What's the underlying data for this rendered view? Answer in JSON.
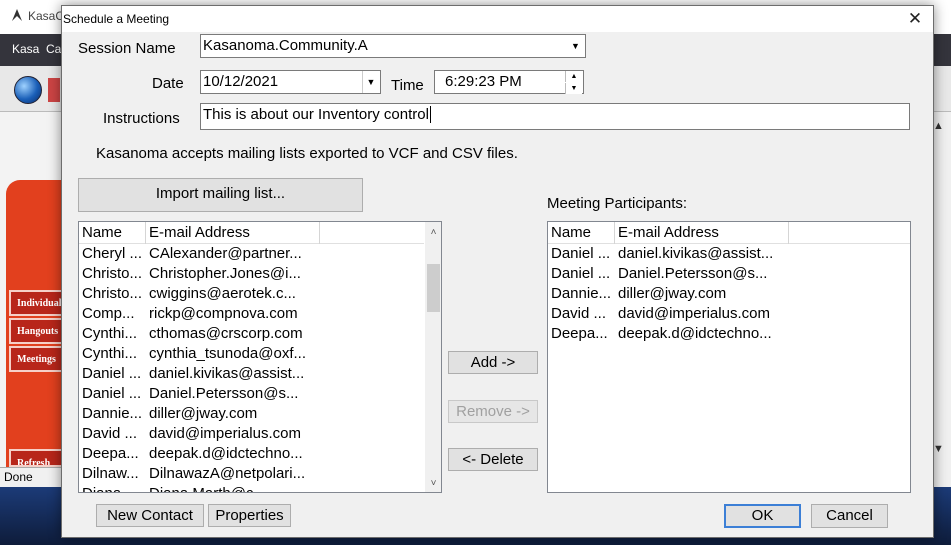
{
  "background_app": {
    "title": "KasaC",
    "menu": [
      "Kasa",
      "Ca"
    ],
    "nav_buttons": [
      "Individuals",
      "Hangouts",
      "Meetings",
      "Refresh"
    ],
    "status": "Done"
  },
  "dialog": {
    "title": "Schedule a Meeting",
    "close_glyph": "✕",
    "session_name": {
      "label": "Session Name",
      "value": "Kasanoma.Community.A"
    },
    "date": {
      "label": "Date",
      "value": "10/12/2021"
    },
    "time": {
      "label": "Time",
      "value": "6:29:23 PM"
    },
    "instructions": {
      "label": "Instructions",
      "value": "This is about our Inventory control"
    },
    "info_text": "Kasanoma accepts mailing lists exported to VCF and CSV files.",
    "import_button": "Import mailing list...",
    "participants_label": "Meeting Participants:",
    "columns": {
      "name": "Name",
      "email": "E-mail Address"
    },
    "contacts": [
      {
        "name": "Cheryl ...",
        "email": "CAlexander@partner..."
      },
      {
        "name": "Christo...",
        "email": "Christopher.Jones@i..."
      },
      {
        "name": "Christo...",
        "email": "cwiggins@aerotek.c..."
      },
      {
        "name": "Comp...",
        "email": "rickp@compnova.com"
      },
      {
        "name": "Cynthi...",
        "email": "cthomas@crscorp.com"
      },
      {
        "name": "Cynthi...",
        "email": "cynthia_tsunoda@oxf..."
      },
      {
        "name": "Daniel ...",
        "email": "daniel.kivikas@assist..."
      },
      {
        "name": "Daniel ...",
        "email": "Daniel.Petersson@s..."
      },
      {
        "name": "Dannie...",
        "email": "diller@jway.com"
      },
      {
        "name": "David ...",
        "email": "david@imperialus.com"
      },
      {
        "name": "Deepa...",
        "email": "deepak.d@idctechno..."
      },
      {
        "name": "Dilnaw...",
        "email": "DilnawazA@netpolari..."
      },
      {
        "name": "Diana ...",
        "email": "Diana.Marth@c..."
      }
    ],
    "participants": [
      {
        "name": "Daniel ...",
        "email": "daniel.kivikas@assist..."
      },
      {
        "name": "Daniel ...",
        "email": "Daniel.Petersson@s..."
      },
      {
        "name": "Dannie...",
        "email": "diller@jway.com"
      },
      {
        "name": "David ...",
        "email": "david@imperialus.com"
      },
      {
        "name": "Deepa...",
        "email": "deepak.d@idctechno..."
      }
    ],
    "buttons": {
      "add": "Add ->",
      "remove": "Remove ->",
      "delete": "<- Delete",
      "new_contact": "New Contact",
      "properties": "Properties",
      "ok": "OK",
      "cancel": "Cancel"
    }
  }
}
